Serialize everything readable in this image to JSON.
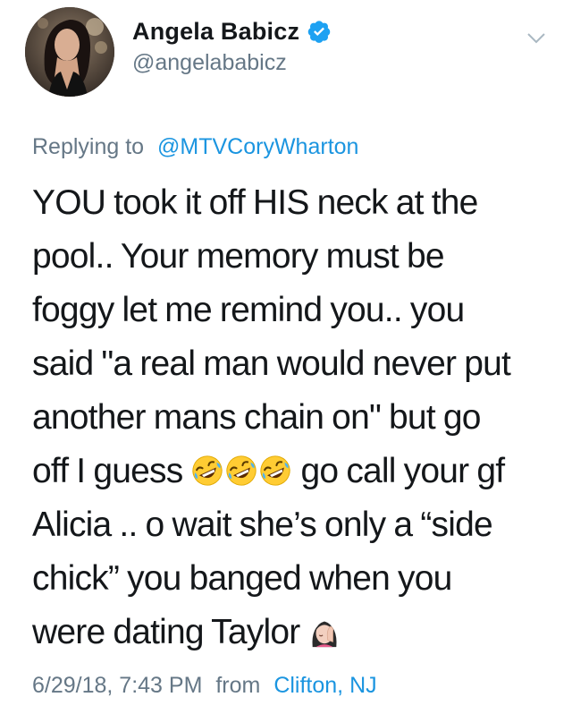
{
  "author": {
    "display_name": "Angela Babicz",
    "handle": "@angelababicz",
    "verified": true,
    "avatar_icon": "profile-photo"
  },
  "reply": {
    "prefix": "Replying to",
    "mention": "@MTVCoryWharton"
  },
  "tweet": {
    "lines": [
      "YOU took it off HIS neck at the",
      "pool.. Your memory must be",
      "foggy let me remind you.. you",
      "said \"a real man would never put",
      "another mans chain on\" but go",
      {
        "before": "off I guess ",
        "emojis": [
          "rofl-emoji",
          "rofl-emoji",
          "rofl-emoji"
        ],
        "after": " go call your gf"
      },
      "Alicia .. o wait she’s only a “side",
      "chick” you banged when you",
      {
        "before": "were dating Taylor ",
        "emojis": [
          "facepalm-woman-emoji"
        ],
        "after": ""
      }
    ]
  },
  "meta": {
    "timestamp": "6/29/18, 7:43 PM",
    "from_label": "from",
    "location": "Clifton, NJ"
  },
  "colors": {
    "text": "#14171a",
    "secondary": "#657786",
    "link": "#1b95e0",
    "verified_badge": "#1da1f2"
  }
}
